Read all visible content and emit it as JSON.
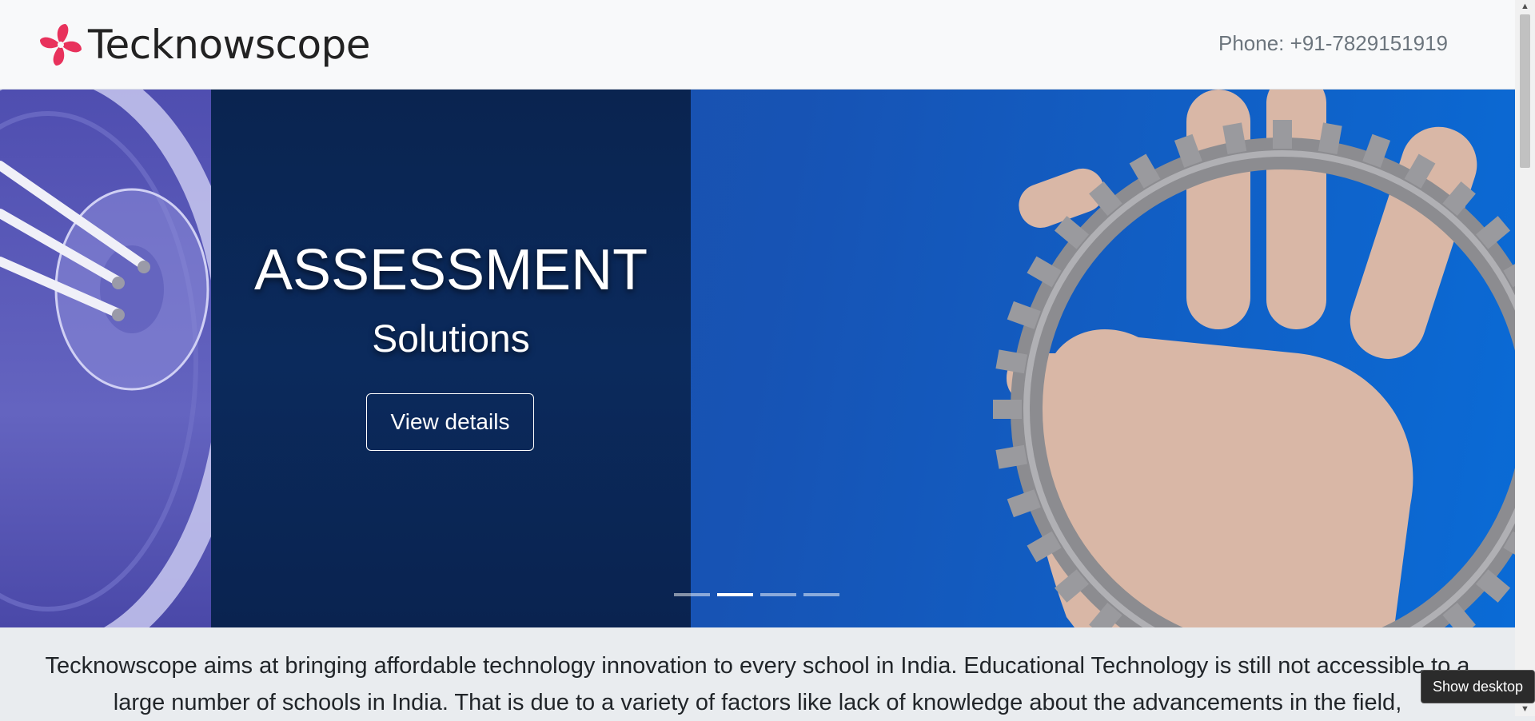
{
  "navbar": {
    "brand_name": "Tecknowscope",
    "phone": "Phone: +91-7829151919"
  },
  "carousel": {
    "title": "ASSESSMENT",
    "subtitle": "Solutions",
    "button_label": "View details",
    "slides_count": 4,
    "active_slide": 2
  },
  "intro": {
    "text": "Tecknowscope aims at bringing affordable technology innovation to every school in India. Educational Technology is still not accessible to a large number of schools in India. That is due to a variety of factors like lack of knowledge about the advancements in the field,"
  },
  "tooltip": {
    "label": "Show desktop"
  },
  "colors": {
    "brand_pink": "#e8325c",
    "navbar_bg": "#f8f9fa",
    "carousel_blue": "#1753b4",
    "caption_panel": "#0b2a5c"
  }
}
